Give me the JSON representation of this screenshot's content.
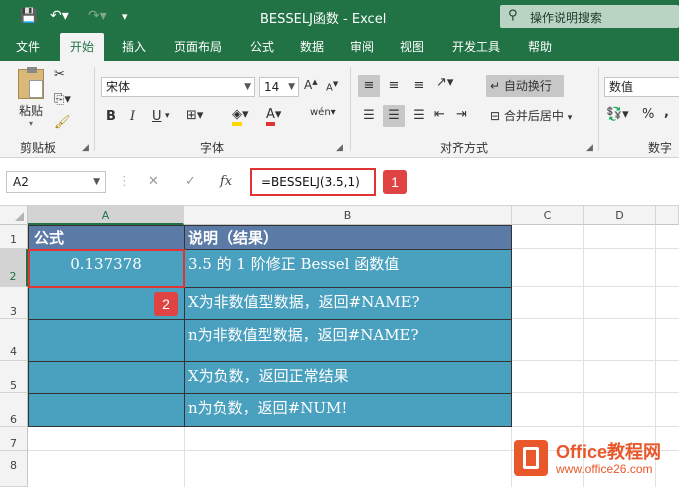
{
  "window": {
    "title": "BESSELJ函数  -  Excel",
    "search_placeholder": "操作说明搜索"
  },
  "tabs": [
    "文件",
    "开始",
    "插入",
    "页面布局",
    "公式",
    "数据",
    "审阅",
    "视图",
    "开发工具",
    "帮助"
  ],
  "ribbon": {
    "clipboard": {
      "paste_label": "粘贴",
      "group_label": "剪贴板"
    },
    "font": {
      "font_name": "宋体",
      "font_size": "14",
      "group_label": "字体",
      "bold": "B",
      "italic": "I",
      "underline": "U",
      "grow": "A",
      "shrink": "A",
      "phonetic": "wén"
    },
    "alignment": {
      "wrap_text": "自动换行",
      "merge_center": "合并后居中",
      "group_label": "对齐方式"
    },
    "number": {
      "format": "数值",
      "percent": "%",
      "comma": ",",
      "group_label": "数字"
    }
  },
  "formula_bar": {
    "name_box": "A2",
    "fx": "fx",
    "formula": "=BESSELJ(3.5,1)",
    "badge": "1"
  },
  "grid": {
    "columns": [
      "A",
      "B",
      "C",
      "D"
    ],
    "rows": [
      "1",
      "2",
      "3",
      "4",
      "5",
      "6",
      "7",
      "8"
    ],
    "header_row": {
      "a": "公式",
      "b": "说明（结果）"
    },
    "data_rows": [
      {
        "a": "0.137378",
        "b": "3.5 的 1 阶修正 Bessel 函数值"
      },
      {
        "a": "",
        "b": "X为非数值型数据，返回#NAME?"
      },
      {
        "a": "",
        "b": "n为非数值型数据，返回#NAME?"
      },
      {
        "a": "",
        "b": "X为负数，返回正常结果"
      },
      {
        "a": "",
        "b": "n为负数，返回#NUM!"
      }
    ],
    "badge2": "2",
    "colors": {
      "header_fill": "#5b7aa5",
      "data_fill": "#4aa0bf",
      "accent": "#217346",
      "callout": "#e03434"
    }
  },
  "watermark": {
    "line1": "Office教程网",
    "line2": "www.office26.com"
  }
}
